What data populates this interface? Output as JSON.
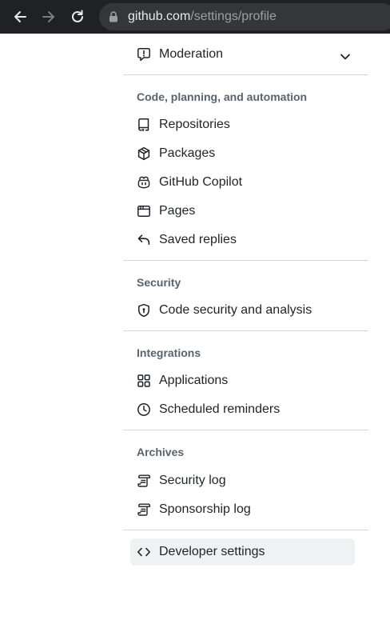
{
  "browser": {
    "url_host": "github.com",
    "url_path": "/settings/profile",
    "icons": [
      "back-arrow-icon",
      "forward-arrow-icon",
      "reload-icon",
      "lock-icon"
    ]
  },
  "sidebar": {
    "moderation": {
      "label": "Moderation",
      "icon": "report-icon"
    },
    "sections": [
      {
        "heading": "Code, planning, and automation",
        "items": [
          {
            "label": "Repositories",
            "icon": "repo-icon"
          },
          {
            "label": "Packages",
            "icon": "package-icon"
          },
          {
            "label": "GitHub Copilot",
            "icon": "copilot-icon"
          },
          {
            "label": "Pages",
            "icon": "browser-icon"
          },
          {
            "label": "Saved replies",
            "icon": "reply-icon"
          }
        ]
      },
      {
        "heading": "Security",
        "items": [
          {
            "label": "Code security and analysis",
            "icon": "shield-lock-icon"
          }
        ]
      },
      {
        "heading": "Integrations",
        "items": [
          {
            "label": "Applications",
            "icon": "apps-icon"
          },
          {
            "label": "Scheduled reminders",
            "icon": "clock-icon"
          }
        ]
      },
      {
        "heading": "Archives",
        "items": [
          {
            "label": "Security log",
            "icon": "log-icon"
          },
          {
            "label": "Sponsorship log",
            "icon": "log-icon"
          }
        ]
      }
    ],
    "developer": {
      "label": "Developer settings",
      "icon": "code-icon",
      "active": true
    }
  },
  "colors": {
    "text": "#1f2328",
    "heading": "#59636e",
    "divider": "#d1d9e0",
    "active_bg": "#eff1f3",
    "chrome_bg": "#202124"
  }
}
